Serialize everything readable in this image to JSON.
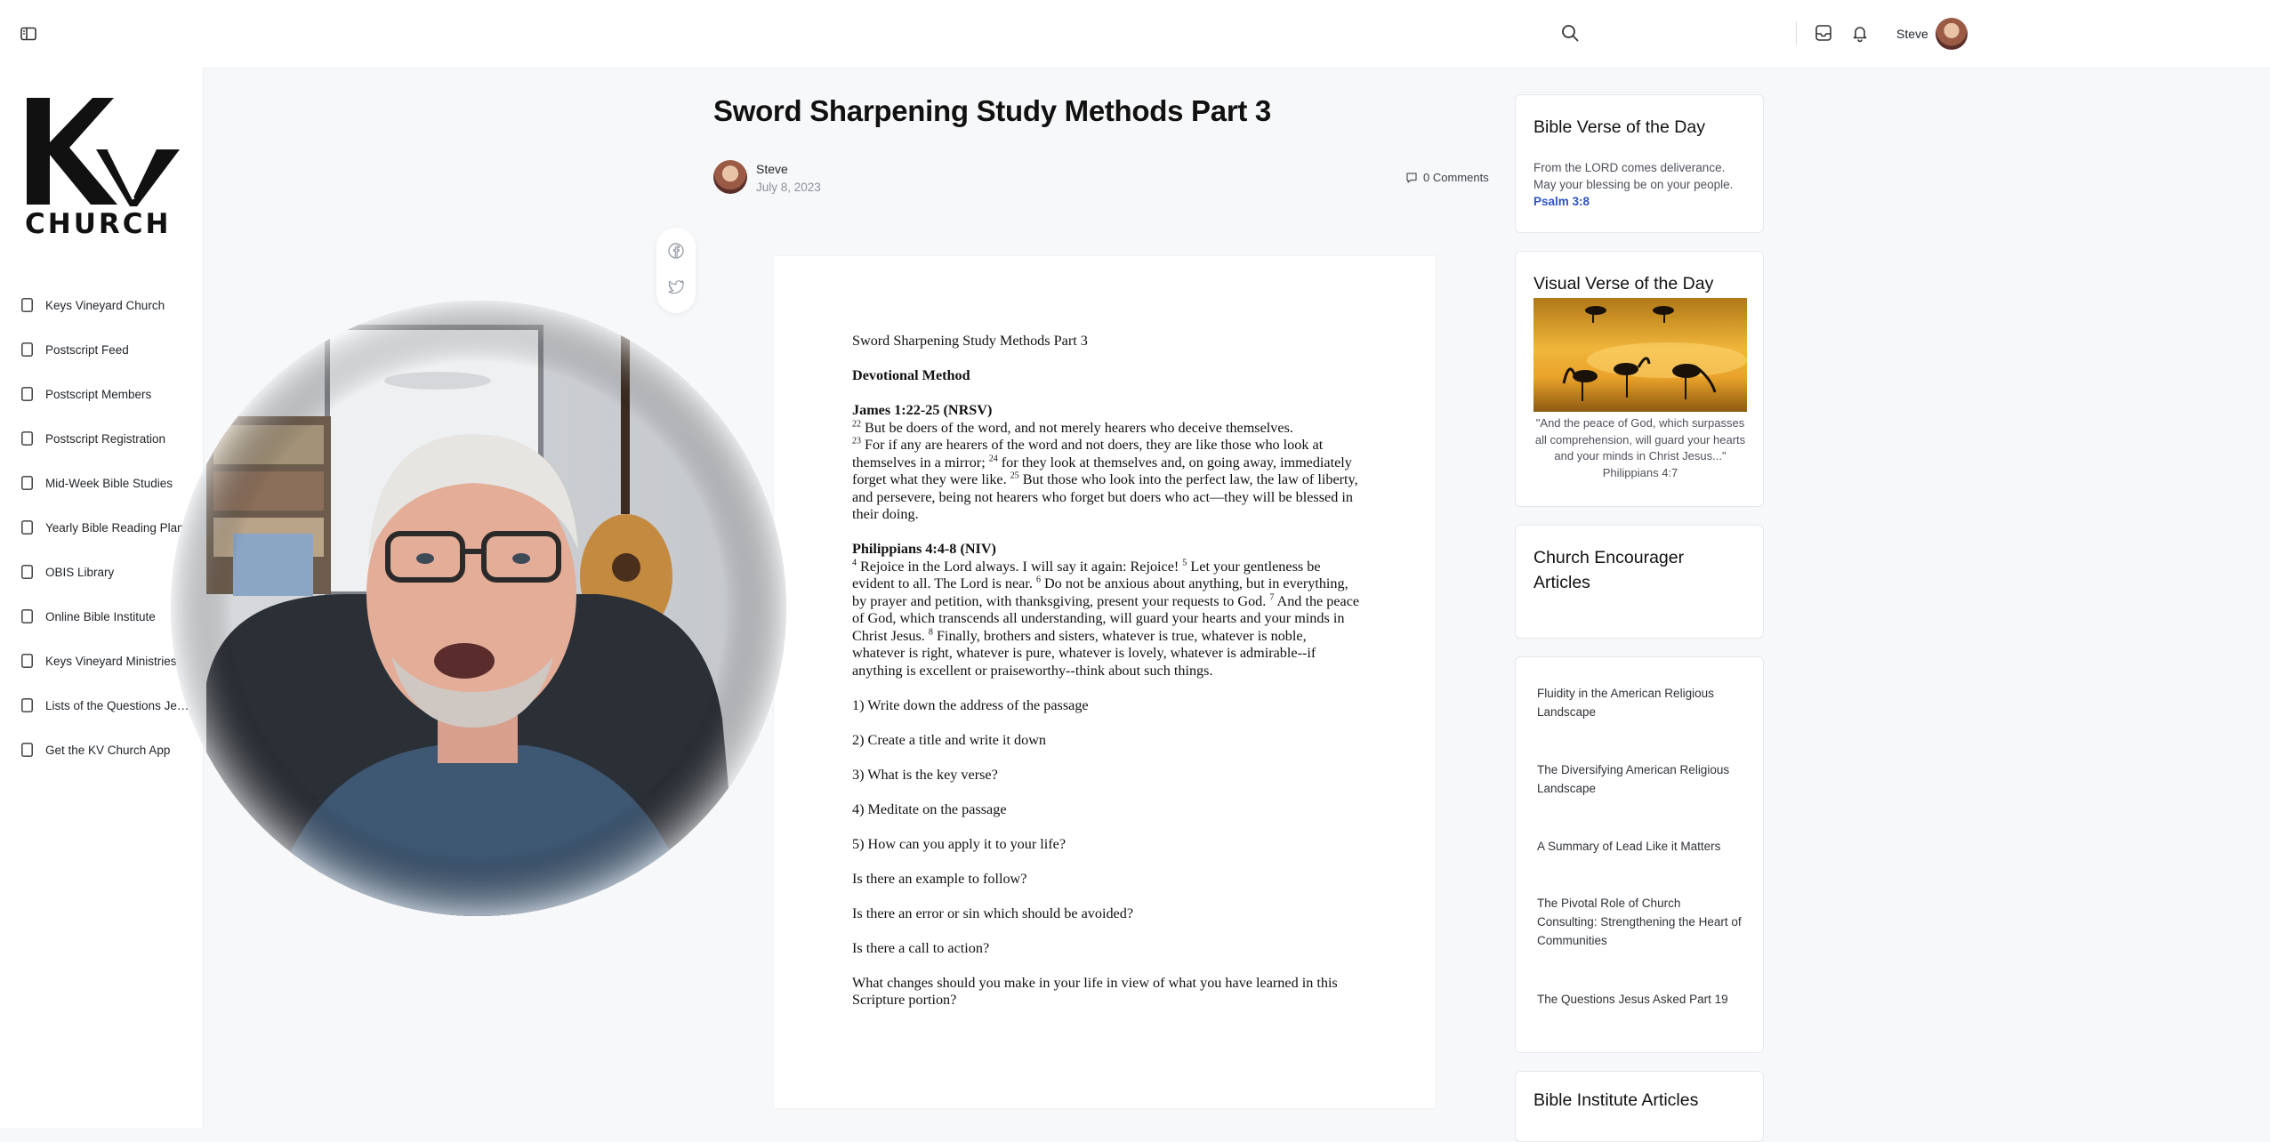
{
  "sidebar": {
    "logo": {
      "mark": "KV",
      "wordmark": "CHURCH"
    },
    "items": [
      {
        "label": "Keys Vineyard Church"
      },
      {
        "label": "Postscript Feed"
      },
      {
        "label": "Postscript Members"
      },
      {
        "label": "Postscript Registration"
      },
      {
        "label": "Mid-Week Bible Studies"
      },
      {
        "label": "Yearly Bible Reading Plan"
      },
      {
        "label": "OBIS Library"
      },
      {
        "label": "Online Bible Institute"
      },
      {
        "label": "Keys Vineyard Ministries"
      },
      {
        "label": "Lists of the Questions Jesu..."
      },
      {
        "label": "Get the KV Church App"
      }
    ]
  },
  "header": {
    "icons": [
      "search-icon",
      "inbox-icon",
      "bell-icon"
    ],
    "user_name": "Steve"
  },
  "post": {
    "title": "Sword Sharpening Study Methods Part 3",
    "author": "Steve",
    "date": "July 8, 2023",
    "comments": "0 Comments",
    "share_icons": [
      "facebook-icon",
      "twitter-icon"
    ]
  },
  "document": {
    "heading": "Sword Sharpening Study Methods Part 3",
    "method": "Devotional Method",
    "passage1_ref": "James 1:22-25 (NRSV)",
    "passage1": [
      {
        "n": "22",
        "t": "But be doers of the word, and not merely hearers who deceive themselves."
      },
      {
        "n": "23",
        "t": "For if any are hearers of the word and not doers, they are like those who look at themselves in a mirror;"
      },
      {
        "n": "24",
        "t": "for they look at themselves and, on going away, immediately forget what they were like."
      },
      {
        "n": "25",
        "t": "But those who look into the perfect law, the law of liberty, and persevere, being not hearers who forget but doers who act—they will be blessed in their doing."
      }
    ],
    "passage2_ref": "Philippians 4:4-8 (NIV)",
    "passage2": [
      {
        "n": "4",
        "t": "Rejoice in the Lord always. I will say it again: Rejoice!"
      },
      {
        "n": "5",
        "t": "Let your gentleness be evident to all. The Lord is near."
      },
      {
        "n": "6",
        "t": "Do not be anxious about anything, but in everything, by prayer and petition, with thanksgiving, present your requests to God."
      },
      {
        "n": "7",
        "t": "And the peace of God, which transcends all understanding, will guard your hearts and your minds in Christ Jesus."
      },
      {
        "n": "8",
        "t": "Finally, brothers and sisters, whatever is true, whatever is noble, whatever is right, whatever is pure, whatever is lovely, whatever is admirable--if anything is excellent or praiseworthy--think about such things."
      }
    ],
    "steps": [
      "1) Write down the address of the passage",
      "2) Create a title and write it down",
      "3) What is the key verse?",
      "4) Meditate on the passage",
      "5) How can you apply it to your life?",
      "Is there an example to follow?",
      "Is there an error or sin which should be avoided?",
      "Is there a call to action?",
      "What changes should you make in your life in view of what you have learned in this Scripture portion?"
    ]
  },
  "widgets": {
    "verse_of_day": {
      "title": "Bible Verse of the Day",
      "text": "From the LORD comes deliverance. May your blessing be on your people.",
      "ref": "Psalm 3:8"
    },
    "visual_verse": {
      "title": "Visual Verse of the Day",
      "caption": "\"And the peace of God, which surpasses all comprehension, will guard your hearts and your minds in Christ Jesus...\" Philippians 4:7"
    },
    "encourager": {
      "title": "Church Encourager Articles"
    },
    "articles": [
      "Fluidity in the American Religious Landscape",
      "The Diversifying American Religious Landscape",
      "A Summary of Lead Like it Matters",
      "The Pivotal Role of Church Consulting: Strengthening the Heart of Communities",
      "The Questions Jesus Asked Part 19"
    ],
    "institute": {
      "title": "Bible Institute Articles"
    }
  },
  "colors": {
    "accent_link": "#2e55c2",
    "background": "#f7f8fa"
  }
}
